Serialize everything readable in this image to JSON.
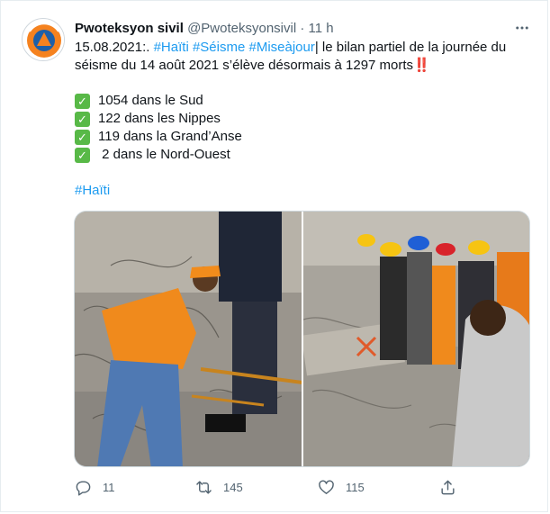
{
  "tweet": {
    "display_name": "Pwoteksyon sivil",
    "handle": "@Pwoteksyonsivil",
    "separator": "·",
    "time": "11 h",
    "text": {
      "date_prefix": "15.08.2021:.",
      "hashtags_line1": [
        "#Haïti",
        "#Séisme",
        "#Miseàjour"
      ],
      "body": "| le bilan partiel de la journée du séisme du 14 août 2021 s’élève désormais à 1297 morts",
      "emphasis": "‼️"
    },
    "list": [
      "1054 dans le Sud",
      "122 dans les Nippes",
      "119 dans la Grand’Anse",
      " 2 dans le Nord-Ouest"
    ],
    "check_glyph": "✓",
    "closing_hashtag": "#Haïti",
    "media": [
      {
        "name": "photo-rescuer-orange-shirt"
      },
      {
        "name": "photo-rescue-team-helmets"
      }
    ],
    "actions": {
      "reply_count": "11",
      "retweet_count": "145",
      "like_count": "115"
    }
  },
  "colors": {
    "link": "#1d9bf0",
    "text": "#0f1419",
    "muted": "#536471",
    "check_green": "#58b947",
    "avatar_orange": "#f5821f",
    "avatar_blue": "#1d5fa8"
  },
  "icons": {
    "avatar": "civil-protection-logo",
    "more": "more-icon",
    "reply": "reply-icon",
    "retweet": "retweet-icon",
    "like": "like-icon",
    "share": "share-icon"
  }
}
